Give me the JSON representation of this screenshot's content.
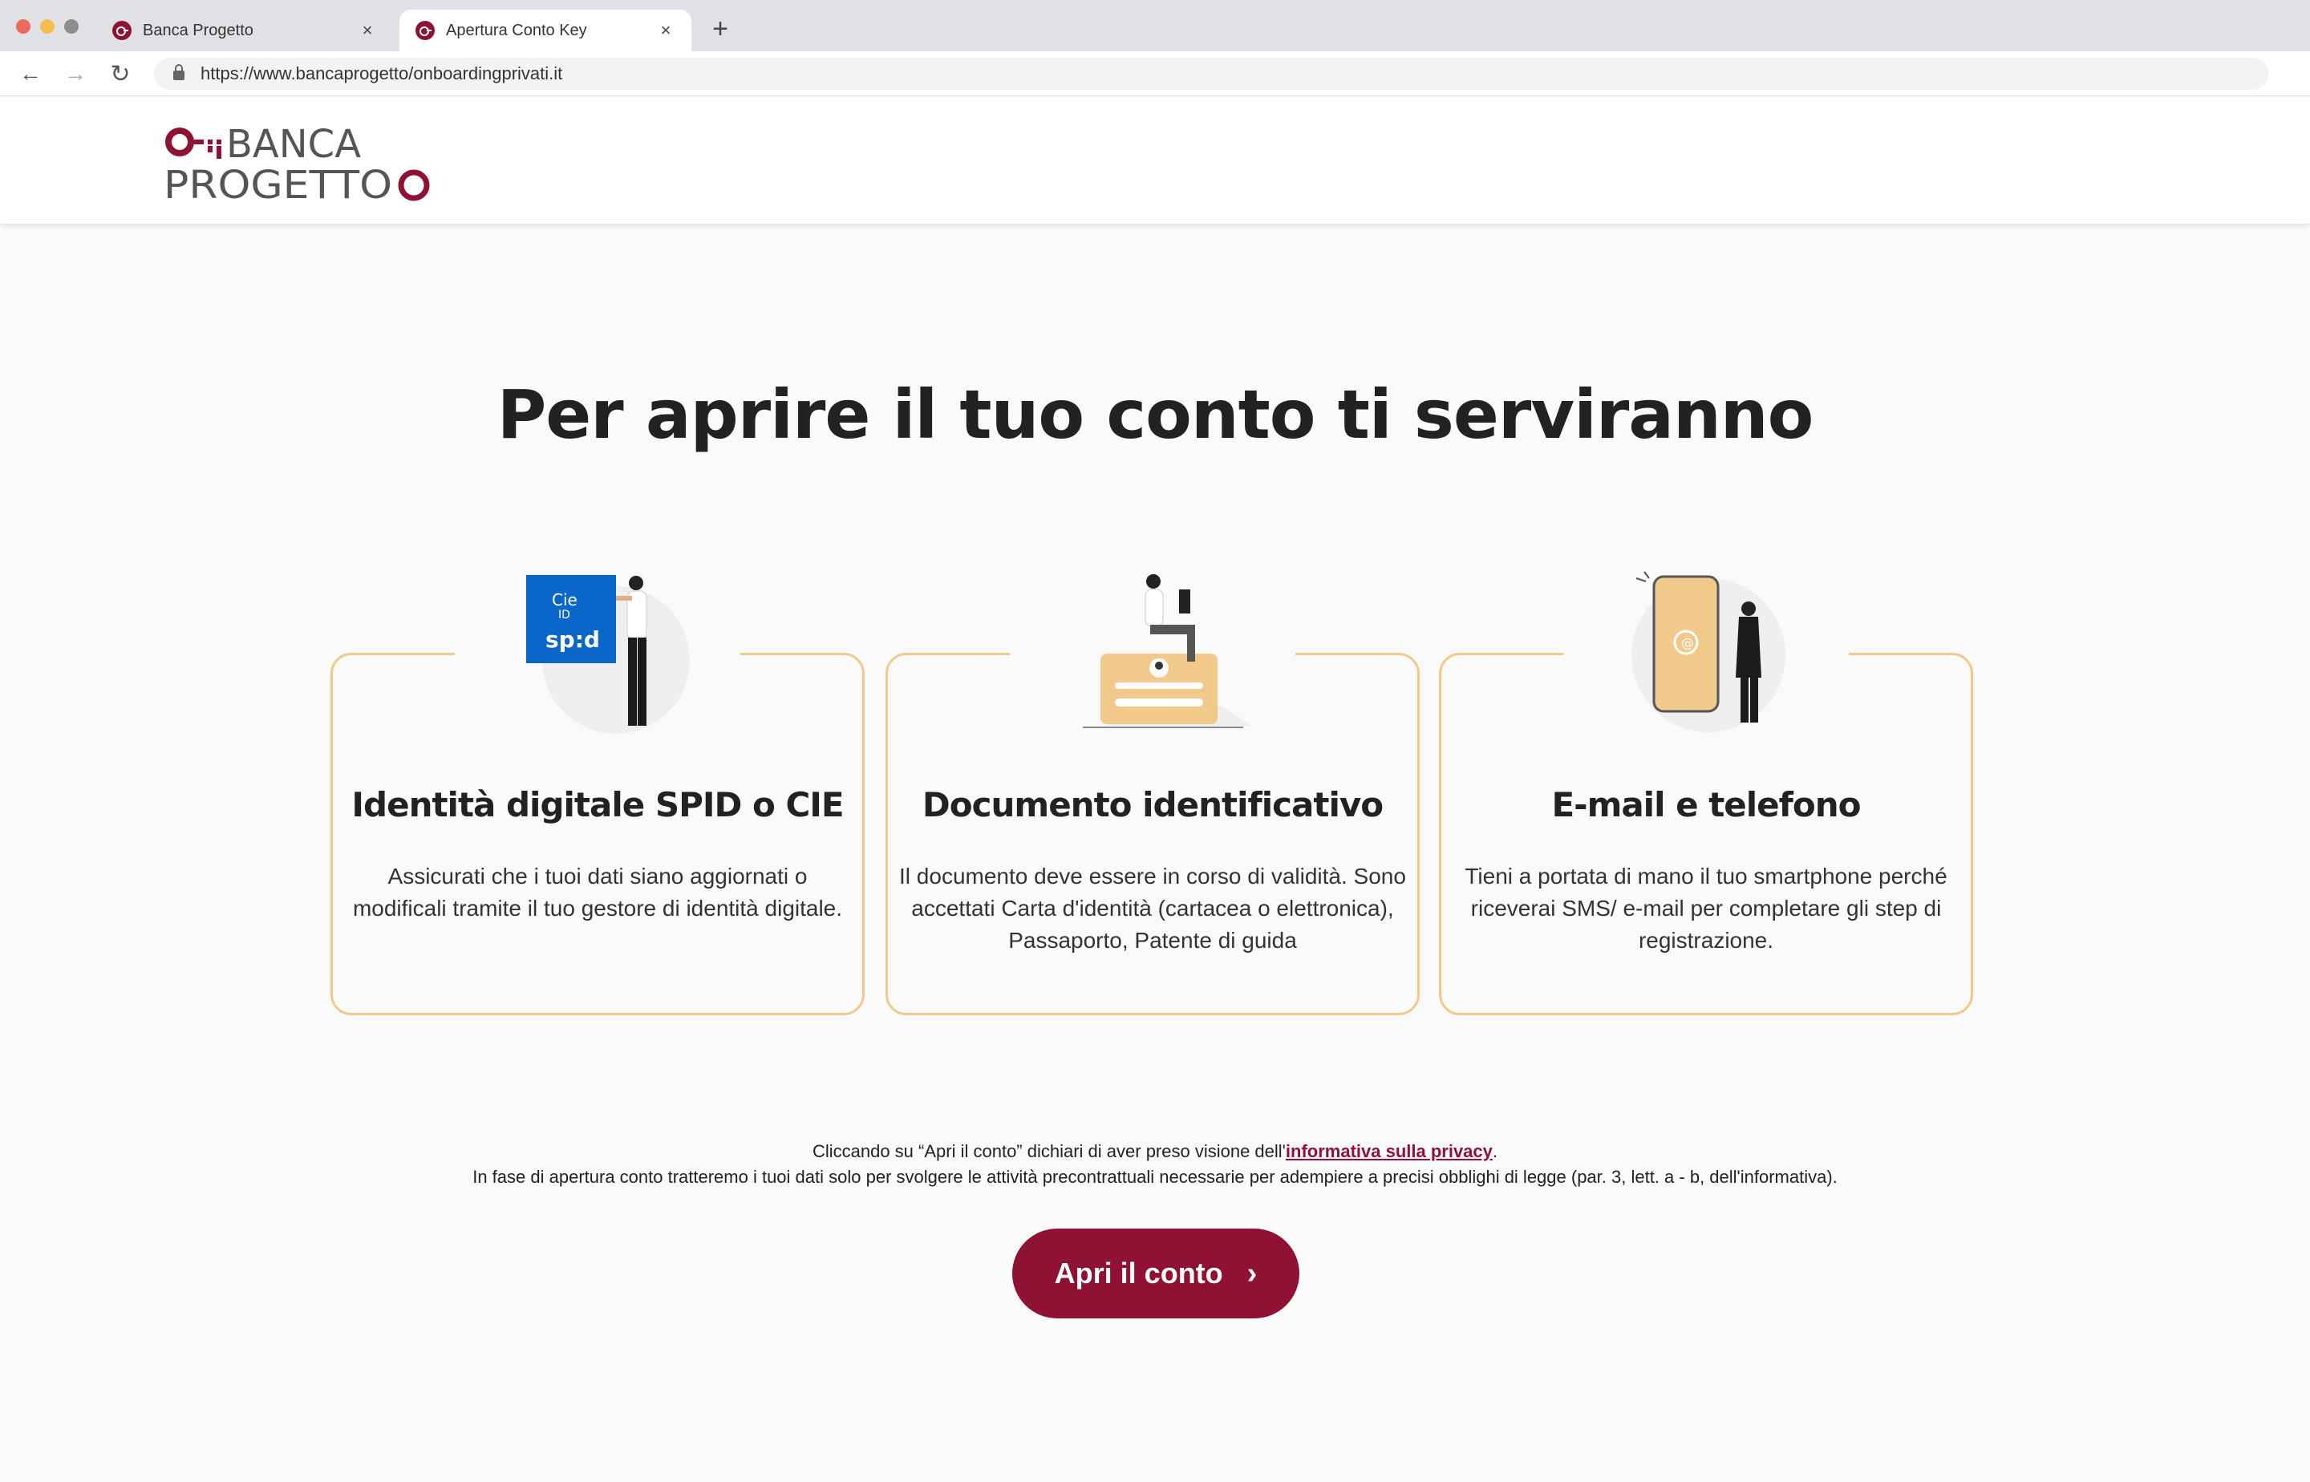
{
  "browser": {
    "tabs": [
      {
        "label": "Banca Progetto",
        "close": "×"
      },
      {
        "label": "Apertura Conto Key",
        "close": "×"
      }
    ],
    "new_tab": "+",
    "nav": {
      "back": "←",
      "forward": "→",
      "reload": "↻"
    },
    "url": "https://www.bancaprogetto/onboardingprivati.it"
  },
  "header": {
    "logo_line1": "BANCA",
    "logo_line2": "PROGETTO",
    "brand_color": "#8f1133"
  },
  "main": {
    "title": "Per aprire il tuo conto ti serviranno",
    "cards": [
      {
        "icon": "spid-cie-illustration",
        "badge_line1": "Cie",
        "badge_line2": "ID",
        "badge_line3": "sp:d",
        "title": "Identità digitale SPID o CIE",
        "text": "Assicurati che i tuoi dati siano aggiornati o modificali tramite il tuo gestore di identità digitale."
      },
      {
        "icon": "id-document-illustration",
        "title": "Documento identificativo",
        "text": "Il documento deve essere in corso di validità. Sono accettati Carta d'identità (cartacea o elettronica), Passaporto, Patente di guida"
      },
      {
        "icon": "email-phone-illustration",
        "title": "E-mail e telefono",
        "text": "Tieni a portata di mano il tuo smartphone perché riceverai SMS/ e-mail per completare gli step di registrazione."
      }
    ],
    "accent_color": "#f1c98b"
  },
  "disclaimer": {
    "line1_before": "Cliccando su “Apri il conto” dichiari di aver preso visione dell'",
    "line1_link": "informativa sulla privacy",
    "line1_after": ".",
    "line2": "In fase di apertura conto tratteremo i tuoi dati solo per svolgere le attività precontrattuali necessarie per adempiere a precisi obblighi di legge (par. 3, lett. a - b, dell'informativa)."
  },
  "cta": {
    "label": "Apri il conto",
    "chevron": "›"
  }
}
